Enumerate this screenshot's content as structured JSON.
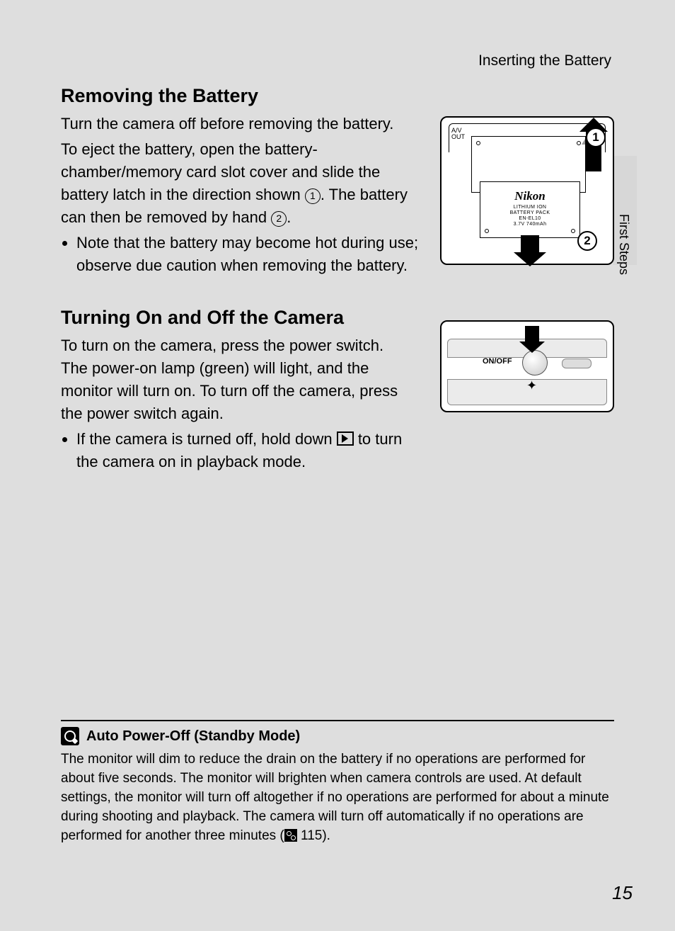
{
  "running_head": "Inserting the Battery",
  "side_tab_label": "First Steps",
  "page_number": "15",
  "section1": {
    "heading": "Removing the Battery",
    "p1": "Turn the camera off before removing the battery.",
    "p2a": "To eject the battery, open the battery-chamber/memory card slot cover and slide the battery latch in the direction shown ",
    "p2b": ". The battery can then be removed by hand ",
    "p2c": ".",
    "step1": "1",
    "step2": "2",
    "bullet1": "Note that the battery may become hot during use; observe due caution when removing the battery."
  },
  "section2": {
    "heading": "Turning On and Off the Camera",
    "p1": "To turn on the camera, press the power switch. The power-on lamp (green) will light, and the monitor will turn on. To turn off the camera, press the power switch again.",
    "bullet1a": "If the camera is turned off, hold down ",
    "bullet1b": " to turn the camera on in playback mode."
  },
  "figure1": {
    "brand": "Nikon",
    "line1": "LITHIUM ION",
    "line2": "BATTERY PACK",
    "line3": "EN-EL10",
    "line4": "3.7V 740mAh",
    "marker1": "1",
    "marker2": "2",
    "port_label": "A/V\nOUT"
  },
  "figure2": {
    "label": "ON/OFF"
  },
  "note": {
    "heading": "Auto Power-Off (Standby Mode)",
    "body_a": "The monitor will dim to reduce the drain on the battery if no operations are performed for about five seconds. The monitor will brighten when camera controls are used. At default settings, the monitor will turn off altogether if no operations are performed for about a minute during shooting and playback. The camera will turn off automatically if no operations are performed for another three minutes (",
    "ref": " 115).",
    "ref_page": "115"
  }
}
